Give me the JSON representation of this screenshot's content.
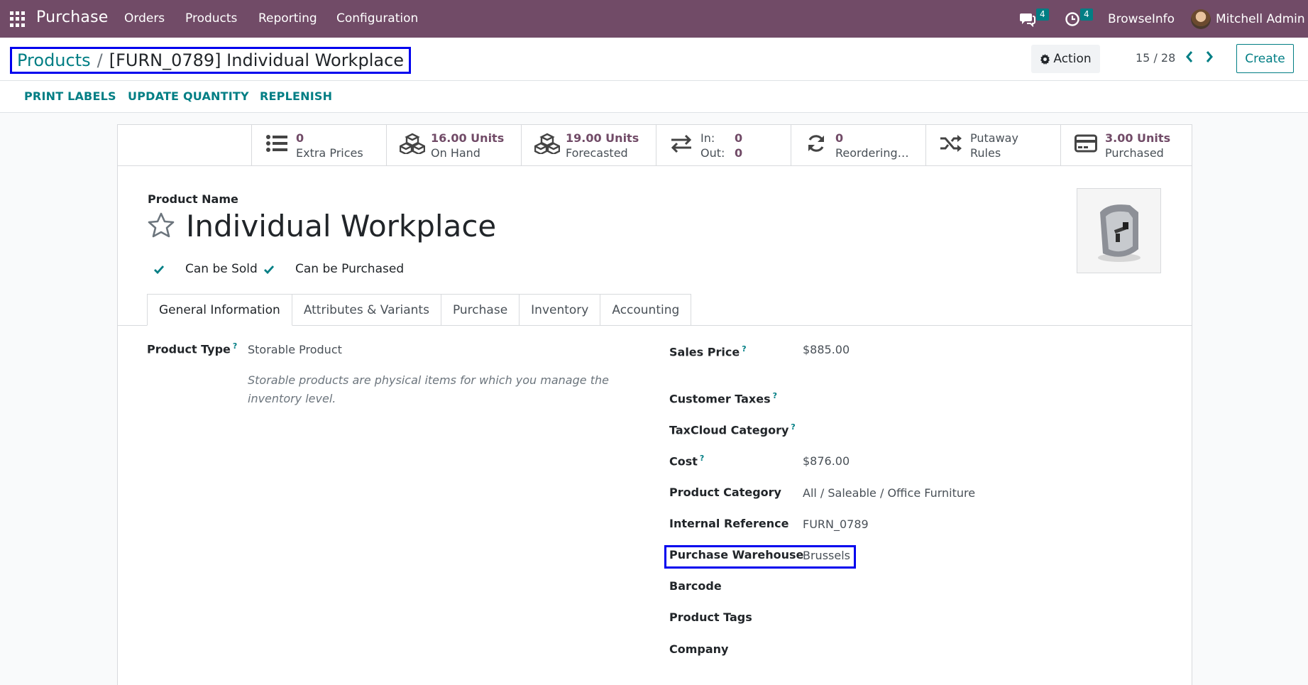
{
  "navbar": {
    "app_name": "Purchase",
    "menu": [
      "Orders",
      "Products",
      "Reporting",
      "Configuration"
    ],
    "messages_count": "4",
    "activities_count": "4",
    "company": "BrowseInfo",
    "user": "Mitchell Admin"
  },
  "control": {
    "breadcrumb_parent": "Products",
    "breadcrumb_separator": "/",
    "breadcrumb_current": "[FURN_0789] Individual Workplace",
    "action_label": "Action",
    "pager": "15 / 28",
    "create_label": "Create"
  },
  "statusbar": {
    "buttons": [
      "PRINT LABELS",
      "UPDATE QUANTITY",
      "REPLENISH"
    ]
  },
  "smart_buttons": [
    {
      "value": "0",
      "label": "Extra Prices",
      "icon": "list-icon"
    },
    {
      "value": "16.00 Units",
      "label": "On Hand",
      "icon": "cubes-icon"
    },
    {
      "value": "19.00 Units",
      "label": "Forecasted",
      "icon": "cubes-icon"
    },
    {
      "in_label": "In:",
      "in_value": "0",
      "out_label": "Out:",
      "out_value": "0",
      "icon": "exchange-icon"
    },
    {
      "value": "0",
      "label": "Reordering…",
      "icon": "refresh-icon"
    },
    {
      "line1": "Putaway",
      "line2": "Rules",
      "icon": "random-icon"
    },
    {
      "value": "3.00 Units",
      "label": "Purchased",
      "icon": "credit-card-icon"
    }
  ],
  "product": {
    "name_label": "Product Name",
    "name": "Individual Workplace",
    "can_be_sold": "Can be Sold",
    "can_be_purchased": "Can be Purchased"
  },
  "tabs": [
    "General Information",
    "Attributes & Variants",
    "Purchase",
    "Inventory",
    "Accounting"
  ],
  "left_fields": {
    "product_type_label": "Product Type",
    "product_type_value": "Storable Product",
    "product_type_help": "Storable products are physical items for which you manage the inventory level."
  },
  "right_fields": [
    {
      "label": "Sales Price",
      "help": "?",
      "value": "$885.00"
    },
    {
      "label": "Customer Taxes",
      "help": "?",
      "value": ""
    },
    {
      "label": "TaxCloud Category",
      "help": "?",
      "value": ""
    },
    {
      "label": "Cost",
      "help": "?",
      "value": "$876.00"
    },
    {
      "label": "Product Category",
      "help": "",
      "value": "All / Saleable / Office Furniture"
    },
    {
      "label": "Internal Reference",
      "help": "",
      "value": "FURN_0789"
    },
    {
      "label": "Purchase Warehouse",
      "help": "",
      "value": "Brussels"
    },
    {
      "label": "Barcode",
      "help": "",
      "value": ""
    },
    {
      "label": "Product Tags",
      "help": "",
      "value": ""
    },
    {
      "label": "Company",
      "help": "",
      "value": ""
    }
  ],
  "colors": {
    "brand": "#714b67",
    "accent": "#017e84",
    "highlight": "#0000ee"
  }
}
